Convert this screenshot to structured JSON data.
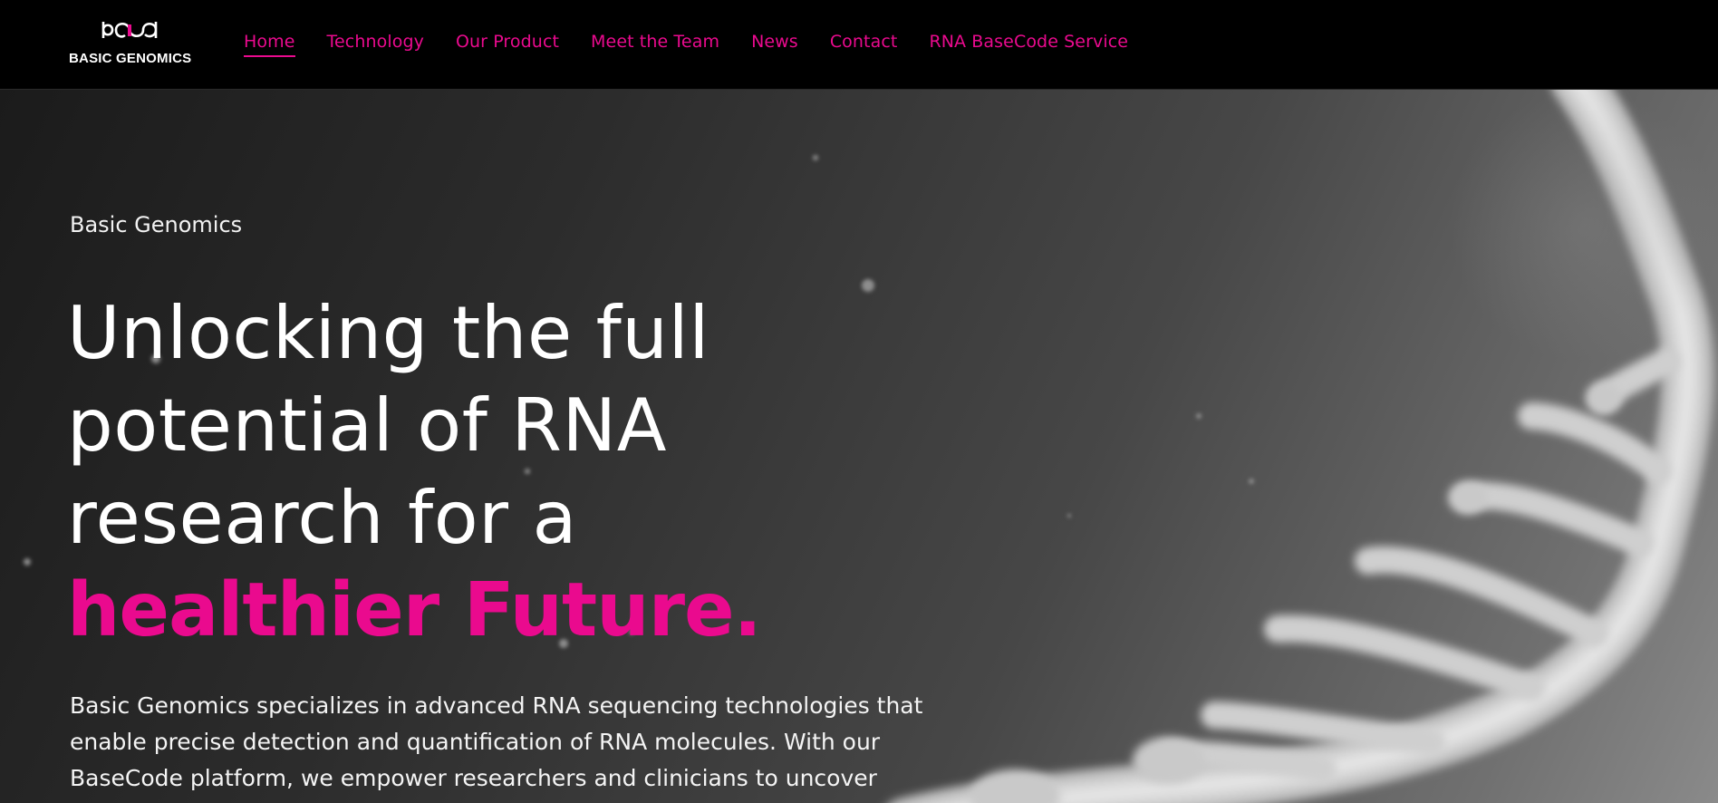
{
  "brand": {
    "logo_icon": "rna-loop-logo-icon",
    "name": "BASIC GENOMICS"
  },
  "nav": {
    "items": [
      {
        "label": "Home",
        "active": true
      },
      {
        "label": "Technology"
      },
      {
        "label": "Our Product"
      },
      {
        "label": "Meet the Team"
      },
      {
        "label": "News"
      },
      {
        "label": "Contact"
      },
      {
        "label": "RNA BaseCode Service"
      }
    ]
  },
  "hero": {
    "eyebrow": "Basic Genomics",
    "headline_lines": [
      "Unlocking the full",
      "potential of RNA",
      "research for a"
    ],
    "headline_accent": "healthier Future.",
    "description": "Basic Genomics specializes in advanced RNA sequencing technologies that enable precise detection and quantification of RNA molecules. With our BaseCode platform, we empower researchers and clinicians to uncover",
    "background_image": "grey-rna-strand-illustration"
  },
  "colors": {
    "accent": "#ea0a8e",
    "topbar": "#000000",
    "text": "#ffffff"
  }
}
